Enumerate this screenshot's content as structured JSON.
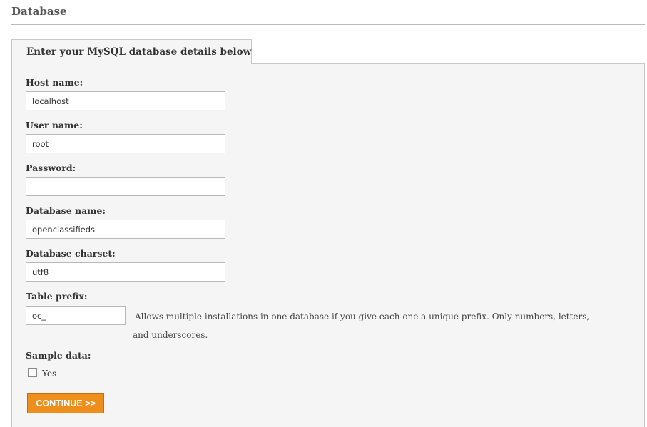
{
  "section": {
    "title": "Database"
  },
  "tab": {
    "label": "Enter your MySQL database details below"
  },
  "form": {
    "host": {
      "label": "Host name:",
      "value": "localhost"
    },
    "user": {
      "label": "User name:",
      "value": "root"
    },
    "password": {
      "label": "Password:",
      "value": ""
    },
    "db_name": {
      "label": "Database name:",
      "value": "openclassifieds"
    },
    "charset": {
      "label": "Database charset:",
      "value": "utf8"
    },
    "prefix": {
      "label": "Table prefix:",
      "value": "oc_",
      "help": "Allows multiple installations in one database if you give each one a unique prefix. Only numbers, letters, and underscores."
    },
    "sample_data": {
      "label": "Sample data:",
      "checkbox_label": "Yes",
      "checked": false
    },
    "continue_label": "CONTINUE >>"
  },
  "colors": {
    "button_bg": "#ee8f1d",
    "panel_bg": "#f5f5f5"
  }
}
